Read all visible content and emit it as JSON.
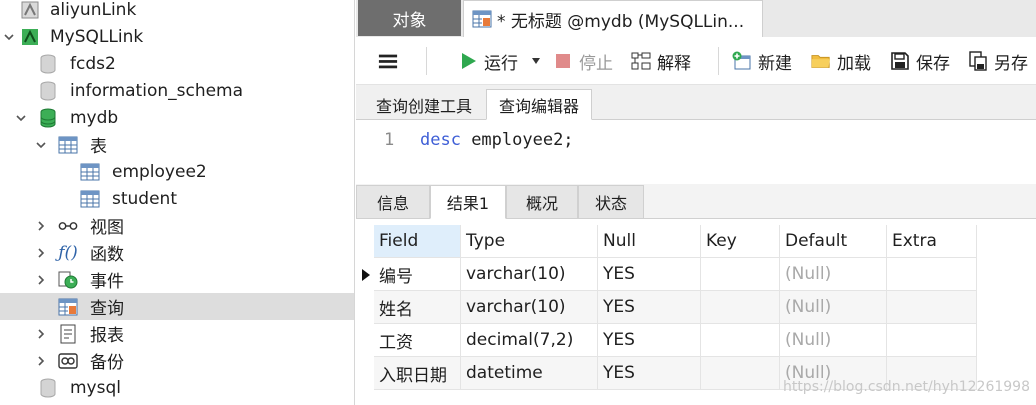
{
  "sidebar": {
    "items": [
      {
        "label": "aliyunLink",
        "icon": "connection-icon"
      },
      {
        "label": "MySQLLink",
        "icon": "connection-icon"
      },
      {
        "label": "fcds2",
        "icon": "database-icon"
      },
      {
        "label": "information_schema",
        "icon": "database-icon"
      },
      {
        "label": "mydb",
        "icon": "database-icon"
      },
      {
        "label": "表",
        "icon": "table-icon"
      },
      {
        "label": "employee2",
        "icon": "table-icon"
      },
      {
        "label": "student",
        "icon": "table-icon"
      },
      {
        "label": "视图",
        "icon": "view-icon"
      },
      {
        "label": "函数",
        "icon": "function-icon"
      },
      {
        "label": "事件",
        "icon": "event-icon"
      },
      {
        "label": "查询",
        "icon": "query-icon"
      },
      {
        "label": "报表",
        "icon": "report-icon"
      },
      {
        "label": "备份",
        "icon": "backup-icon"
      },
      {
        "label": "mysql",
        "icon": "database-icon"
      }
    ]
  },
  "tabs": {
    "objects": "对象",
    "query": "* 无标题 @mydb (MySQLLin..."
  },
  "toolbar": {
    "run": "运行",
    "stop": "停止",
    "explain": "解释",
    "new": "新建",
    "load": "加载",
    "save": "保存",
    "save_as": "另存"
  },
  "subtabs": {
    "builder": "查询创建工具",
    "editor": "查询编辑器"
  },
  "editor": {
    "line_number": "1",
    "keyword": "desc",
    "rest": " employee2;"
  },
  "result_tabs": [
    "信息",
    "结果1",
    "概况",
    "状态"
  ],
  "grid": {
    "columns": [
      "Field",
      "Type",
      "Null",
      "Key",
      "Default",
      "Extra"
    ],
    "rows": [
      [
        "编号",
        "varchar(10)",
        "YES",
        "",
        "(Null)",
        ""
      ],
      [
        "姓名",
        "varchar(10)",
        "YES",
        "",
        "(Null)",
        ""
      ],
      [
        "工资",
        "decimal(7,2)",
        "YES",
        "",
        "(Null)",
        ""
      ],
      [
        "入职日期",
        "datetime",
        "YES",
        "",
        "(Null)",
        ""
      ]
    ]
  },
  "watermark": "https://blog.csdn.net/hyh12261998",
  "colors": {
    "accent_green": "#2fa84f",
    "selection_gray": "#dddddd",
    "keyword_blue": "#3f5fd6",
    "header_blue": "#dfeefb"
  }
}
